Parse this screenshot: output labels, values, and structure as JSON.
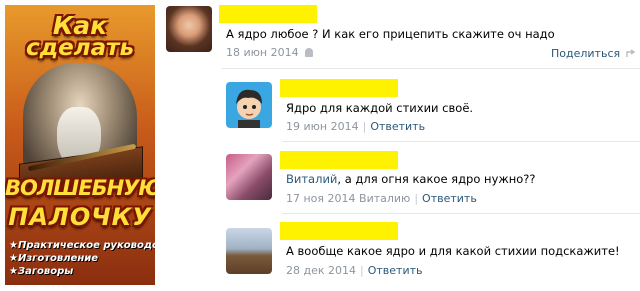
{
  "ad": {
    "title_line1": "Как",
    "title_line2": "сделать",
    "title_line3": "ВОЛШЕБНУЮ",
    "title_line4": "ПАЛОЧКУ",
    "bullets": [
      "Практическое руководство",
      "Изготовление",
      "Заговоры"
    ]
  },
  "comments": [
    {
      "text": "А ядро любое ? И как его прицепить скажите оч надо",
      "date": "18 июн 2014",
      "share_label": "Поделиться"
    },
    {
      "text": "Ядро для каждой стихии своё.",
      "date": "19 июн 2014",
      "reply_label": "Ответить"
    },
    {
      "mention": "Виталий",
      "text": ", а для огня какое ядро нужно??",
      "date": "17 ноя 2014",
      "reply_to": "Виталию",
      "reply_label": "Ответить"
    },
    {
      "text": "А вообще какое ядро и для какой стихии подскажите!",
      "date": "28 дек 2014",
      "reply_label": "Ответить"
    }
  ],
  "colors": {
    "link": "#2b587a",
    "meta": "#8e959e",
    "name_redaction": "#fff200"
  },
  "icons": [
    "android-icon",
    "share-icon"
  ]
}
